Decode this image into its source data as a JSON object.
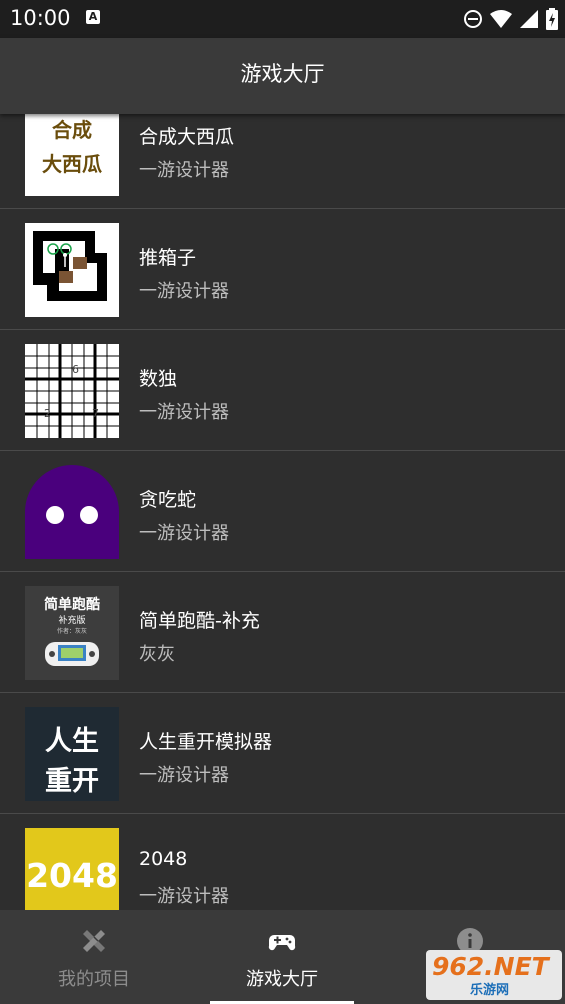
{
  "status_bar": {
    "time": "10:00",
    "notification_badge": "A"
  },
  "app_bar": {
    "title": "游戏大厅"
  },
  "games": [
    {
      "title": "合成大西瓜",
      "author": "一游设计器",
      "thumb_lines": [
        "合成",
        "大西瓜"
      ]
    },
    {
      "title": "推箱子",
      "author": "一游设计器"
    },
    {
      "title": "数独",
      "author": "一游设计器",
      "thumb_digits": [
        "6",
        "2",
        "7"
      ]
    },
    {
      "title": "贪吃蛇",
      "author": "一游设计器"
    },
    {
      "title": "简单跑酷-补充",
      "author": "灰灰",
      "thumb_lines": [
        "简单跑酷",
        "补充版",
        "作者：灰灰"
      ]
    },
    {
      "title": "人生重开模拟器",
      "author": "一游设计器",
      "thumb_lines": [
        "人生",
        "重开"
      ]
    },
    {
      "title": "2048",
      "author": "一游设计器",
      "thumb_lines": [
        "2048"
      ]
    }
  ],
  "bottom_nav": {
    "tabs": [
      {
        "label": "我的项目",
        "icon": "pencil-ruler-icon",
        "active": false
      },
      {
        "label": "游戏大厅",
        "icon": "gamepad-icon",
        "active": true
      },
      {
        "label": "",
        "icon": "info-icon",
        "active": false
      }
    ]
  },
  "watermark": {
    "main": "962.NET",
    "sub": "乐游网"
  },
  "colors": {
    "background": "#2e2e2e",
    "app_bar": "#3a3a3a",
    "status_bar": "#1e1e1e",
    "active_tab": "#ffffff",
    "inactive_tab": "#8d8d8d"
  }
}
